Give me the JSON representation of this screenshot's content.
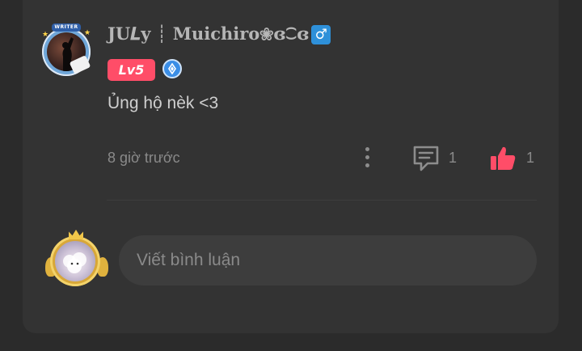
{
  "comment": {
    "author": {
      "username": "J𝐔𝑳y ┊ Muichiro❀ɞ⁐ɞ",
      "gender_symbol": "♂",
      "level_label": "Lv5",
      "avatar_frame_text": "WRITER"
    },
    "text": "Ủng hộ nèk <3",
    "time": "8 giờ trước",
    "reply_count": "1",
    "like_count": "1",
    "icons": {
      "more": "more-vertical-icon",
      "reply": "comment-bubble-icon",
      "like": "thumbs-up-icon",
      "verified": "verified-badge-icon"
    }
  },
  "composer": {
    "placeholder": "Viết bình luận"
  },
  "colors": {
    "background": "#2b2b2b",
    "card": "#333333",
    "level_badge": "#ff4d68",
    "like_active": "#ff4d68",
    "gender_badge": "#2e90d9",
    "input_bg": "#3d3d3d"
  }
}
